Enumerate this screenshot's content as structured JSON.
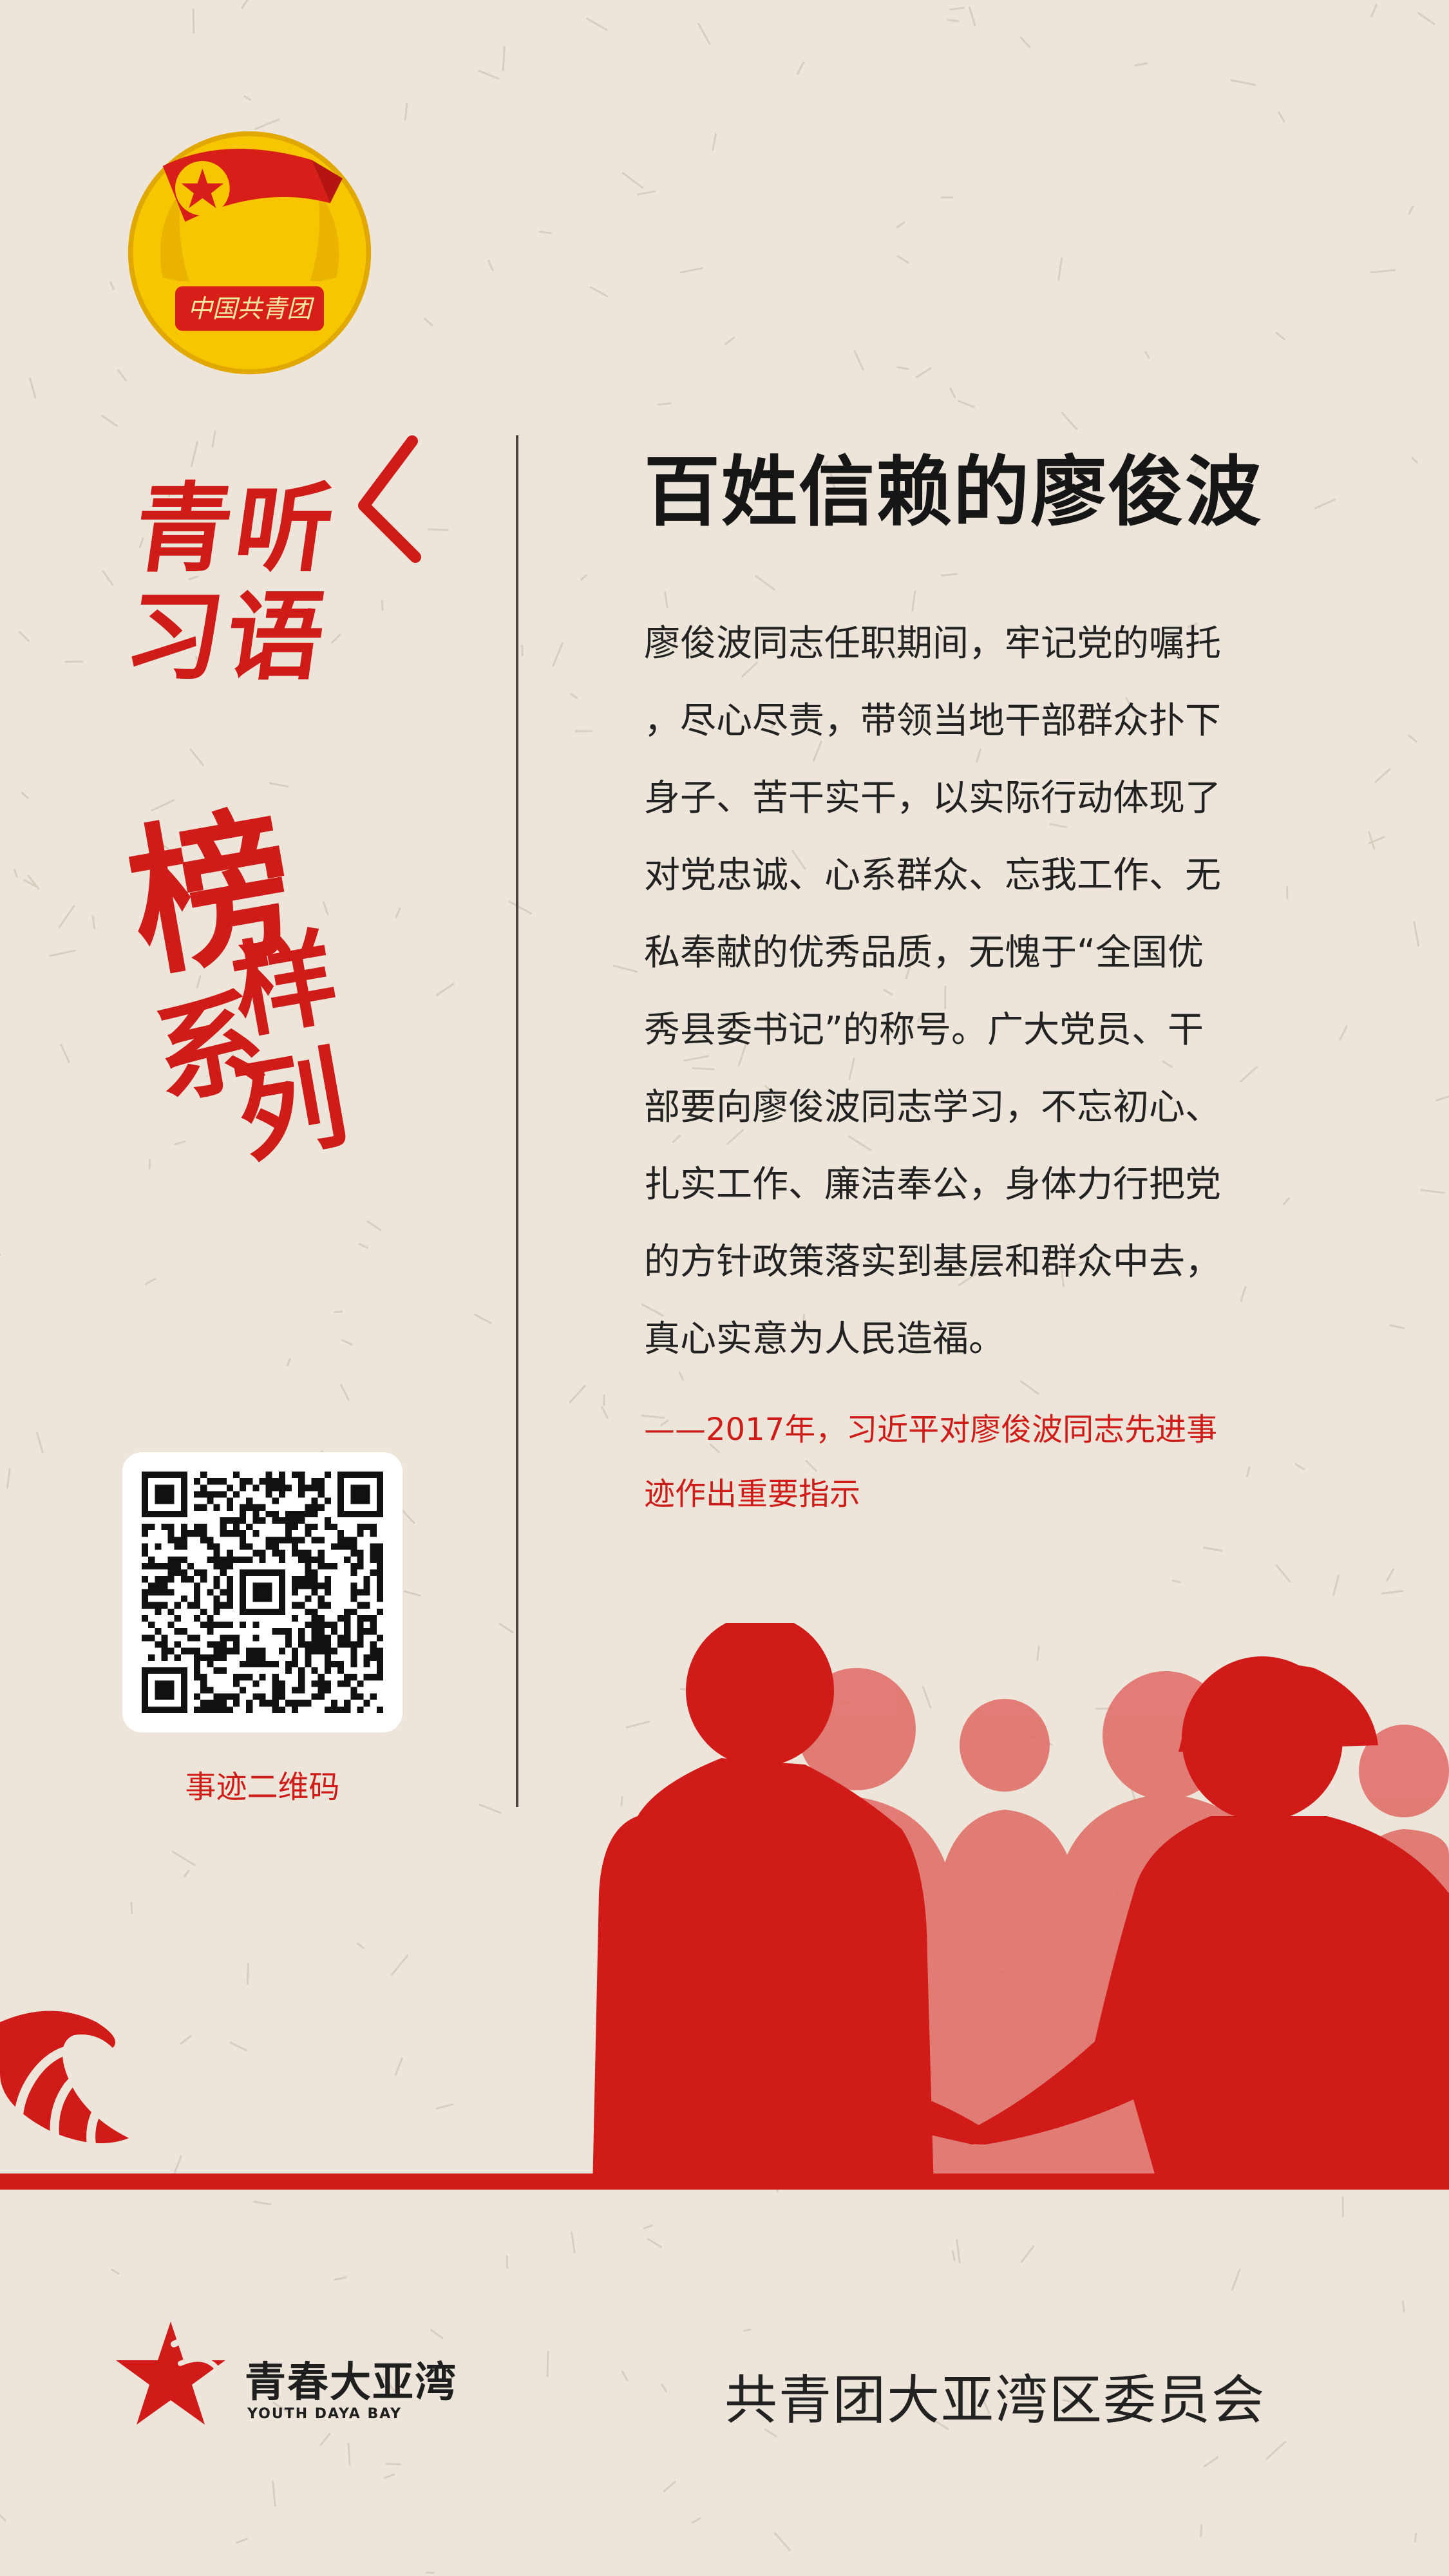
{
  "colors": {
    "background": "#ede5da",
    "accent_red": "#cf1c19",
    "light_red": "#e06a64",
    "text_dark": "#222222",
    "emblem_gold": "#f7c600"
  },
  "emblem": {
    "icon": "communist-youth-league-emblem",
    "ribbon_text": "中国共青团"
  },
  "brand": {
    "line1": "青听",
    "line2": "习语"
  },
  "series": {
    "chars": [
      "榜",
      "样",
      "系",
      "列"
    ]
  },
  "headline": "百姓信赖的廖俊波",
  "body_lines": [
    "廖俊波同志任职期间，牢记党的嘱托",
    "，尽心尽责，带领当地干部群众扑下",
    "身子、苦干实干，以实际行动体现了",
    "对党忠诚、心系群众、忘我工作、无",
    "私奉献的优秀品质，无愧于“全国优",
    "秀县委书记”的称号。广大党员、干",
    "部要向廖俊波同志学习，不忘初心、",
    "扎实工作、廉洁奉公，身体力行把党",
    "的方针政策落实到基层和群众中去，",
    "真心实意为人民造福。"
  ],
  "quote_lines": [
    "——2017年，习近平对廖俊波同志先进事",
    "迹作出重要指示"
  ],
  "qr": {
    "caption": "事迹二维码",
    "icon": "qr-code"
  },
  "footer": {
    "logo_icon": "star-wave-logo",
    "brand_cn": "青春大亚湾",
    "brand_en": "YOUTH DAYA BAY",
    "org": "共青团大亚湾区委员会"
  }
}
